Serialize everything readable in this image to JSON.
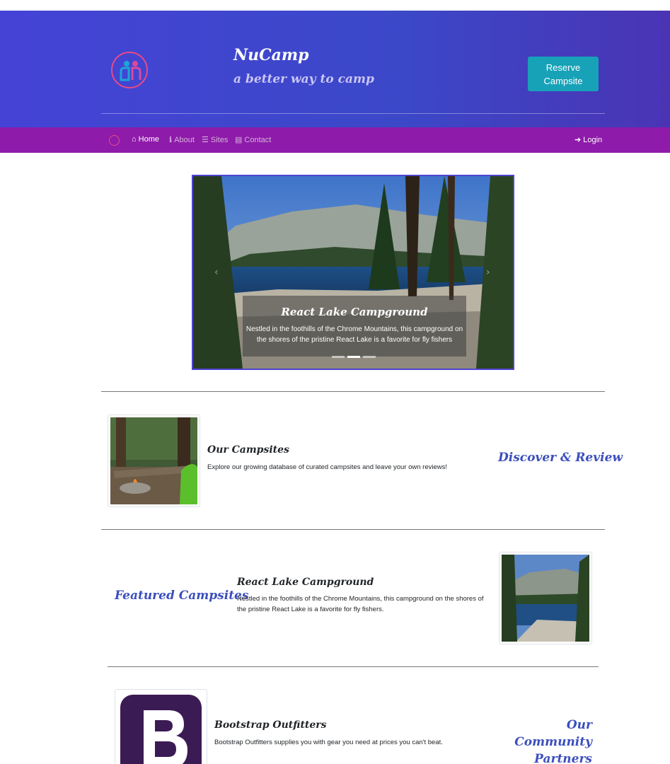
{
  "header": {
    "brand": "NuCamp",
    "tagline": "a better way to camp",
    "reserve_label": "Reserve Campsite"
  },
  "nav": {
    "items": [
      {
        "label": "Home",
        "icon": "home-icon",
        "active": true
      },
      {
        "label": "About",
        "icon": "info-icon",
        "active": false
      },
      {
        "label": "Sites",
        "icon": "list-icon",
        "active": false
      },
      {
        "label": "Contact",
        "icon": "address-card-icon",
        "active": false
      }
    ],
    "login_label": "Login"
  },
  "carousel": {
    "title": "React Lake Campground",
    "text": "Nestled in the foothills of the Chrome Mountains, this campground on the shores of the pristine React Lake is a favorite for fly fishers",
    "active_slide": 2,
    "slide_count": 3
  },
  "campsites": {
    "title": "Our Campsites",
    "text": "Explore our growing database of curated campsites and leave your own reviews!",
    "tagline": "Discover & Review"
  },
  "featured": {
    "heading": "Featured Campsites",
    "title": "React Lake Campground",
    "text": "Nestled in the foothills of the Chrome Mountains, this campground on the shores of the pristine React Lake is a favorite for fly fishers."
  },
  "partners": {
    "title": "Bootstrap Outfitters",
    "text": "Bootstrap Outfitters supplies you with gear you need at prices you can't beat.",
    "heading": "Our Community Partners"
  },
  "colors": {
    "header_gradient": "#4543d6",
    "navbar": "#8e1ba9",
    "reserve_button": "#17a2b8",
    "accent_heading": "#3c4fbd"
  }
}
